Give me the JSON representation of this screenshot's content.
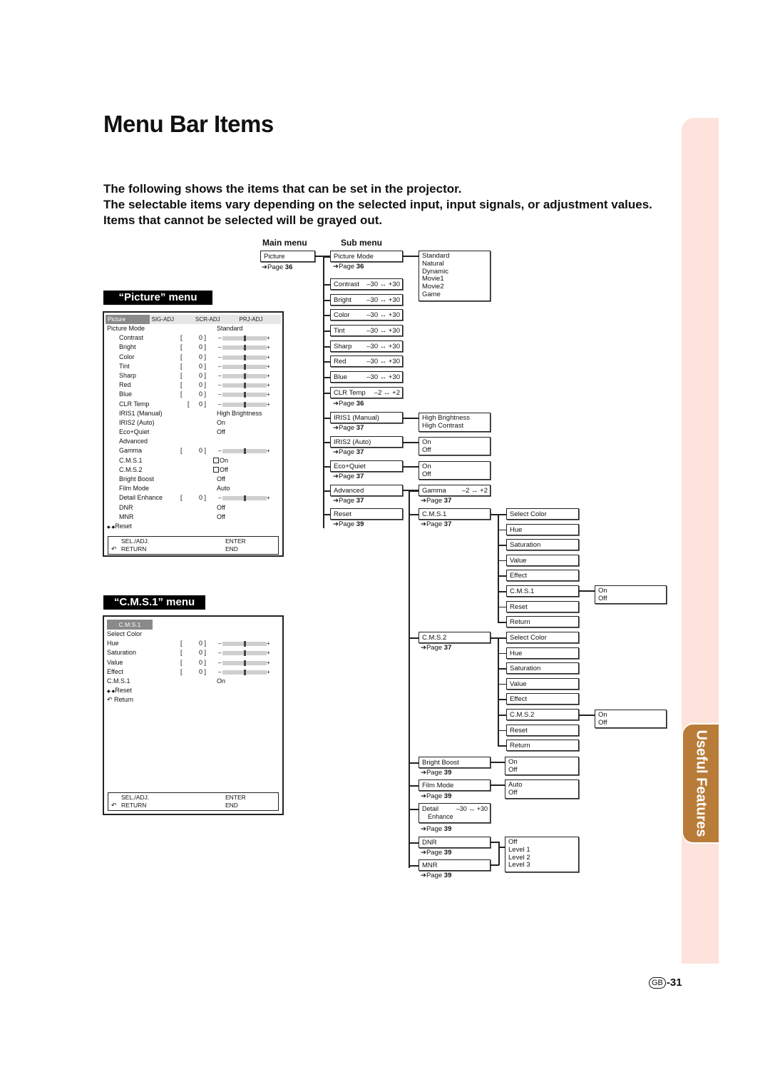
{
  "page": {
    "title": "Menu Bar Items",
    "intro": [
      "The following shows the items that can be set in the projector.",
      "The selectable items vary depending on the selected input, input signals, or adjustment values. Items that cannot be selected will be grayed out."
    ],
    "side_tab": "Useful Features",
    "page_prefix": "GB",
    "page_number": "-31",
    "colors": {
      "side_tab_bg": "#fde3dc",
      "side_tab": "#b87c38",
      "osd_active_tab": "#8a8a8a"
    }
  },
  "picture_osd": {
    "section_label": "“Picture” menu",
    "tabs": [
      "Picture",
      "SIG-ADJ",
      "SCR-ADJ",
      "PRJ-ADJ"
    ],
    "active_tab": "Picture",
    "rows": [
      {
        "label": "Picture Mode",
        "value": "Standard"
      },
      {
        "label": "Contrast",
        "number": "0",
        "slider": 0.5
      },
      {
        "label": "Bright",
        "number": "0",
        "slider": 0.5
      },
      {
        "label": "Color",
        "number": "0",
        "slider": 0.5
      },
      {
        "label": "Tint",
        "number": "0",
        "slider": 0.5
      },
      {
        "label": "Sharp",
        "number": "0",
        "slider": 0.5
      },
      {
        "label": "Red",
        "number": "0",
        "slider": 0.5
      },
      {
        "label": "Blue",
        "number": "0",
        "slider": 0.5
      },
      {
        "label": "CLR Temp",
        "number": "0",
        "slider": 0.5
      },
      {
        "label": "IRIS1 (Manual)",
        "value": "High Brightness"
      },
      {
        "label": "IRIS2 (Auto)",
        "value": "On"
      },
      {
        "label": "Eco+Quiet",
        "value": "Off"
      },
      {
        "label": "Advanced",
        "value": ""
      },
      {
        "label": "Gamma",
        "number": "0",
        "slider": 0.5
      },
      {
        "label": "C.M.S.1",
        "value": "On",
        "checkbox": true
      },
      {
        "label": "C.M.S.2",
        "value": "Off",
        "checkbox": true
      },
      {
        "label": "Bright Boost",
        "value": "Off"
      },
      {
        "label": "Film Mode",
        "value": "Auto"
      },
      {
        "label": "Detail Enhance",
        "number": "0",
        "slider": 0.5
      },
      {
        "label": "DNR",
        "value": "Off"
      },
      {
        "label": "MNR",
        "value": "Off"
      },
      {
        "label": "Reset",
        "value": ""
      }
    ],
    "footer": {
      "sel_adj": "SEL./ADJ.",
      "enter": "ENTER",
      "return": "RETURN",
      "end": "END"
    }
  },
  "cms_osd": {
    "section_label": "“C.M.S.1” menu",
    "tab": "C.M.S.1",
    "rows": [
      {
        "label": "Select Color",
        "value": ""
      },
      {
        "label": "Hue",
        "number": "0",
        "slider": 0.5
      },
      {
        "label": "Saturation",
        "number": "0",
        "slider": 0.5
      },
      {
        "label": "Value",
        "number": "0",
        "slider": 0.5
      },
      {
        "label": "Effect",
        "number": "0",
        "slider": 0.5
      },
      {
        "label": "C.M.S.1",
        "value": "On"
      },
      {
        "label": "Reset",
        "value": ""
      },
      {
        "label": "Return",
        "value": ""
      }
    ],
    "footer": {
      "sel_adj": "SEL./ADJ.",
      "enter": "ENTER",
      "return": "RETURN",
      "end": "END"
    }
  },
  "tree": {
    "main_menu_header": "Main menu",
    "sub_menu_header": "Sub menu",
    "page_word": "Page",
    "main": {
      "label": "Picture",
      "page": "36"
    },
    "sub": [
      {
        "label": "Picture Mode",
        "page": "36",
        "options": "Standard\nNatural\nDynamic\nMovie1\nMovie2\nGame"
      },
      {
        "label": "Contrast",
        "range": "–30 ↔ +30"
      },
      {
        "label": "Bright",
        "range": "–30 ↔ +30"
      },
      {
        "label": "Color",
        "range": "–30 ↔ +30"
      },
      {
        "label": "Tint",
        "range": "–30 ↔ +30"
      },
      {
        "label": "Sharp",
        "range": "–30 ↔ +30"
      },
      {
        "label": "Red",
        "range": "–30 ↔ +30"
      },
      {
        "label": "Blue",
        "range": "–30 ↔ +30"
      },
      {
        "label": "CLR Temp",
        "range": "–2 ↔ +2",
        "page": "36"
      },
      {
        "label": "IRIS1 (Manual)",
        "page": "37",
        "options": "High Brightness\nHigh Contrast"
      },
      {
        "label": "IRIS2 (Auto)",
        "page": "37",
        "options": "On\nOff"
      },
      {
        "label": "Eco+Quiet",
        "page": "37",
        "options": "On\nOff"
      },
      {
        "label": "Advanced",
        "page": "37"
      },
      {
        "label": "Reset",
        "page": "39"
      }
    ],
    "advanced": [
      {
        "label": "Gamma",
        "range": "–2 ↔ +2",
        "page": "37"
      },
      {
        "label": "C.M.S.1",
        "page": "37"
      },
      {
        "label": "C.M.S.2",
        "page": "37"
      },
      {
        "label": "Bright Boost",
        "page": "39",
        "options": "On\nOff"
      },
      {
        "label": "Film Mode",
        "page": "39",
        "options": "Auto\nOff"
      },
      {
        "label": "Detail",
        "label2": "Enhance",
        "range": "–30 ↔ +30",
        "page": "39"
      },
      {
        "label": "DNR",
        "page": "39"
      },
      {
        "label": "MNR",
        "page": "39"
      }
    ],
    "dnr_mnr_options": "Off\nLevel 1\nLevel 2\nLevel 3",
    "cms1_items": [
      "Select Color",
      "Hue",
      "Saturation",
      "Value",
      "Effect",
      "C.M.S.1",
      "Reset",
      "Return"
    ],
    "cms2_items": [
      "Select Color",
      "Hue",
      "Saturation",
      "Value",
      "Effect",
      "C.M.S.2",
      "Reset",
      "Return"
    ],
    "cms_onoff": "On\nOff"
  }
}
